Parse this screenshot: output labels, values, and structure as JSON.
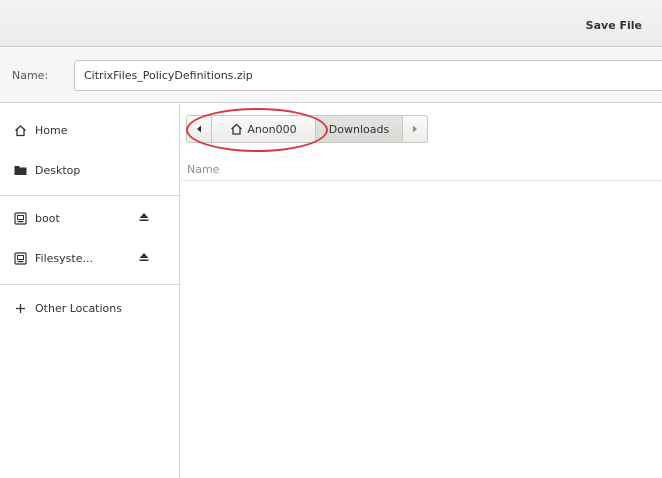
{
  "window": {
    "title": "Save File"
  },
  "name_field": {
    "label": "Name:",
    "value": "CitrixFiles_PolicyDefinitions.zip"
  },
  "sidebar": {
    "places": [
      {
        "label": "Home",
        "icon": "home-icon"
      },
      {
        "label": "Desktop",
        "icon": "folder-icon"
      }
    ],
    "devices": [
      {
        "label": "boot",
        "icon": "drive-icon",
        "eject_icon": "eject-icon"
      },
      {
        "label": "Filesyste...",
        "icon": "drive-icon",
        "eject_icon": "eject-icon"
      }
    ],
    "other": {
      "label": "Other Locations",
      "icon": "plus-icon"
    }
  },
  "pathbar": {
    "back_icon": "chevron-left-icon",
    "home_label": "Anon000",
    "current_label": "Downloads",
    "forward_icon": "chevron-right-icon"
  },
  "file_list": {
    "column_name": "Name"
  },
  "annotation_color": "#d9383f"
}
